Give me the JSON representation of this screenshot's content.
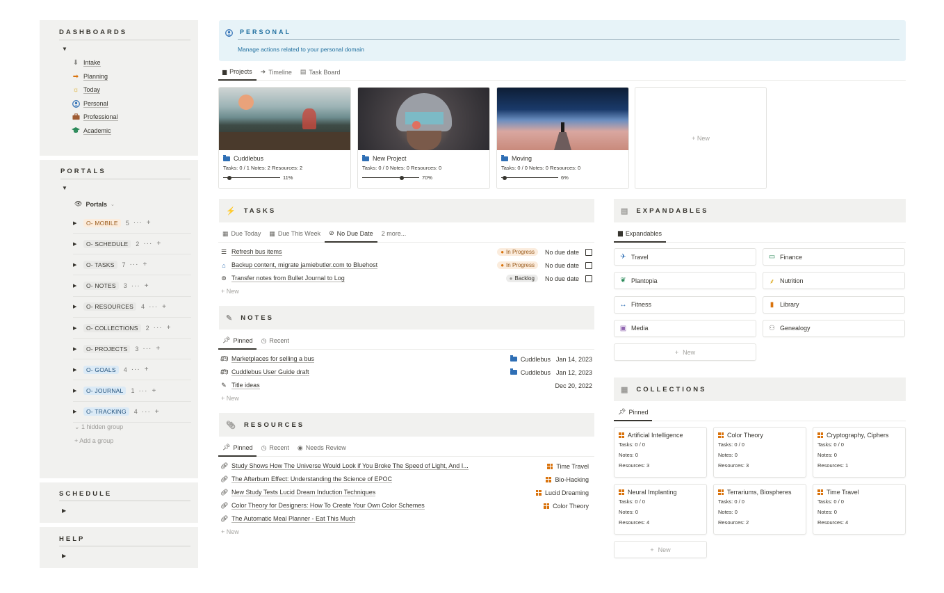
{
  "sidebar": {
    "dashboards": {
      "title": "DASHBOARDS",
      "items": [
        {
          "label": "Intake",
          "icon": "down-arrow-icon"
        },
        {
          "label": "Planning",
          "icon": "right-arrow-icon"
        },
        {
          "label": "Today",
          "icon": "sun-icon"
        },
        {
          "label": "Personal",
          "icon": "person-icon"
        },
        {
          "label": "Professional",
          "icon": "briefcase-icon"
        },
        {
          "label": "Academic",
          "icon": "graduation-cap-icon"
        }
      ]
    },
    "portals": {
      "title": "PORTALS",
      "view_label": "Portals",
      "rows": [
        {
          "tag": "O- MOBILE",
          "count": "5",
          "color": "#fbecdd",
          "text": "#9a5a1a"
        },
        {
          "tag": "O- SCHEDULE",
          "count": "2",
          "color": "#e9e9e7",
          "text": "#37352f"
        },
        {
          "tag": "O- TASKS",
          "count": "7",
          "color": "#e9e9e7",
          "text": "#37352f"
        },
        {
          "tag": "O- NOTES",
          "count": "3",
          "color": "#e9e9e7",
          "text": "#37352f"
        },
        {
          "tag": "O- RESOURCES",
          "count": "4",
          "color": "#e9e9e7",
          "text": "#37352f"
        },
        {
          "tag": "O- COLLECTIONS",
          "count": "2",
          "color": "#e9e9e7",
          "text": "#37352f"
        },
        {
          "tag": "O- PROJECTS",
          "count": "3",
          "color": "#e9e9e7",
          "text": "#37352f"
        },
        {
          "tag": "O- GOALS",
          "count": "4",
          "color": "#dbeaf6",
          "text": "#1f4f7a"
        },
        {
          "tag": "O- JOURNAL",
          "count": "1",
          "color": "#dbeaf6",
          "text": "#1f4f7a"
        },
        {
          "tag": "O- TRACKING",
          "count": "4",
          "color": "#dbeaf6",
          "text": "#1f4f7a"
        }
      ],
      "hidden_group": "1 hidden group",
      "add_group": "Add a group"
    },
    "schedule": {
      "title": "SCHEDULE"
    },
    "help": {
      "title": "HELP"
    }
  },
  "header": {
    "title": "PERSONAL",
    "subtitle": "Manage actions related to your personal domain"
  },
  "project_tabs": [
    "Projects",
    "Timeline",
    "Task Board"
  ],
  "projects": [
    {
      "name": "Cuddlebus",
      "stats": "Tasks: 0 / 1 Notes: 2 Resources: 2",
      "progress": "11%",
      "progress_value": 0.11
    },
    {
      "name": "New Project",
      "stats": "Tasks: 0 / 0 Notes: 0 Resources: 0",
      "progress": "70%",
      "progress_value": 0.7
    },
    {
      "name": "Moving",
      "stats": "Tasks: 0 / 0 Notes: 0 Resources: 0",
      "progress": "6%",
      "progress_value": 0.06
    }
  ],
  "new_label": "New",
  "tasks": {
    "title": "TASKS",
    "tabs": [
      "Due Today",
      "Due This Week",
      "No Due Date",
      "2 more..."
    ],
    "rows": [
      {
        "name": "Refresh bus items",
        "status": "In Progress",
        "due": "No due date"
      },
      {
        "name": "Backup content, migrate jamiebutler.com to Bluehost",
        "status": "In Progress",
        "due": "No due date"
      },
      {
        "name": "Transfer notes from Bullet Journal to Log",
        "status": "Backlog",
        "due": "No due date"
      }
    ]
  },
  "notes": {
    "title": "NOTES",
    "tabs": [
      "Pinned",
      "Recent"
    ],
    "rows": [
      {
        "name": "Marketplaces for selling a bus",
        "project": "Cuddlebus",
        "date": "Jan 14, 2023"
      },
      {
        "name": "Cuddlebus User Guide draft",
        "project": "Cuddlebus",
        "date": "Jan 12, 2023"
      },
      {
        "name": "Title ideas",
        "project": "",
        "date": "Dec 20, 2022"
      }
    ]
  },
  "resources": {
    "title": "RESOURCES",
    "tabs": [
      "Pinned",
      "Recent",
      "Needs Review"
    ],
    "rows": [
      {
        "name": "Study Shows How The Universe Would Look if You Broke The Speed of Light, And I...",
        "collection": "Time Travel"
      },
      {
        "name": "The Afterburn Effect: Understanding the Science of EPOC",
        "collection": "Bio-Hacking"
      },
      {
        "name": "New Study Tests Lucid Dream Induction Techniques",
        "collection": "Lucid Dreaming"
      },
      {
        "name": "Color Theory for Designers: How To Create Your Own Color Schemes",
        "collection": "Color Theory"
      },
      {
        "name": "The Automatic Meal Planner - Eat This Much",
        "collection": ""
      }
    ]
  },
  "expandables": {
    "title": "EXPANDABLES",
    "tab": "Expandables",
    "items": [
      {
        "label": "Travel",
        "icon": "airplane-icon"
      },
      {
        "label": "Finance",
        "icon": "money-icon"
      },
      {
        "label": "Plantopia",
        "icon": "leaf-icon"
      },
      {
        "label": "Nutrition",
        "icon": "carrot-icon"
      },
      {
        "label": "Fitness",
        "icon": "dumbbell-icon"
      },
      {
        "label": "Library",
        "icon": "bookmark-icon"
      },
      {
        "label": "Media",
        "icon": "film-icon"
      },
      {
        "label": "Genealogy",
        "icon": "family-icon"
      }
    ]
  },
  "collections": {
    "title": "COLLECTIONS",
    "tab": "Pinned",
    "items": [
      {
        "name": "Artificial Intelligence",
        "tasks": "Tasks: 0 / 0",
        "notes": "Notes: 0",
        "resources": "Resources: 3"
      },
      {
        "name": "Color Theory",
        "tasks": "Tasks: 0 / 0",
        "notes": "Notes: 0",
        "resources": "Resources: 3"
      },
      {
        "name": "Cryptography, Ciphers",
        "tasks": "Tasks: 0 / 0",
        "notes": "Notes: 0",
        "resources": "Resources: 1"
      },
      {
        "name": "Neural Implanting",
        "tasks": "Tasks: 0 / 0",
        "notes": "Notes: 0",
        "resources": "Resources: 4"
      },
      {
        "name": "Terrariums, Biospheres",
        "tasks": "Tasks: 0 / 0",
        "notes": "Notes: 0",
        "resources": "Resources: 2"
      },
      {
        "name": "Time Travel",
        "tasks": "Tasks: 0 / 0",
        "notes": "Notes: 0",
        "resources": "Resources: 4"
      }
    ]
  }
}
